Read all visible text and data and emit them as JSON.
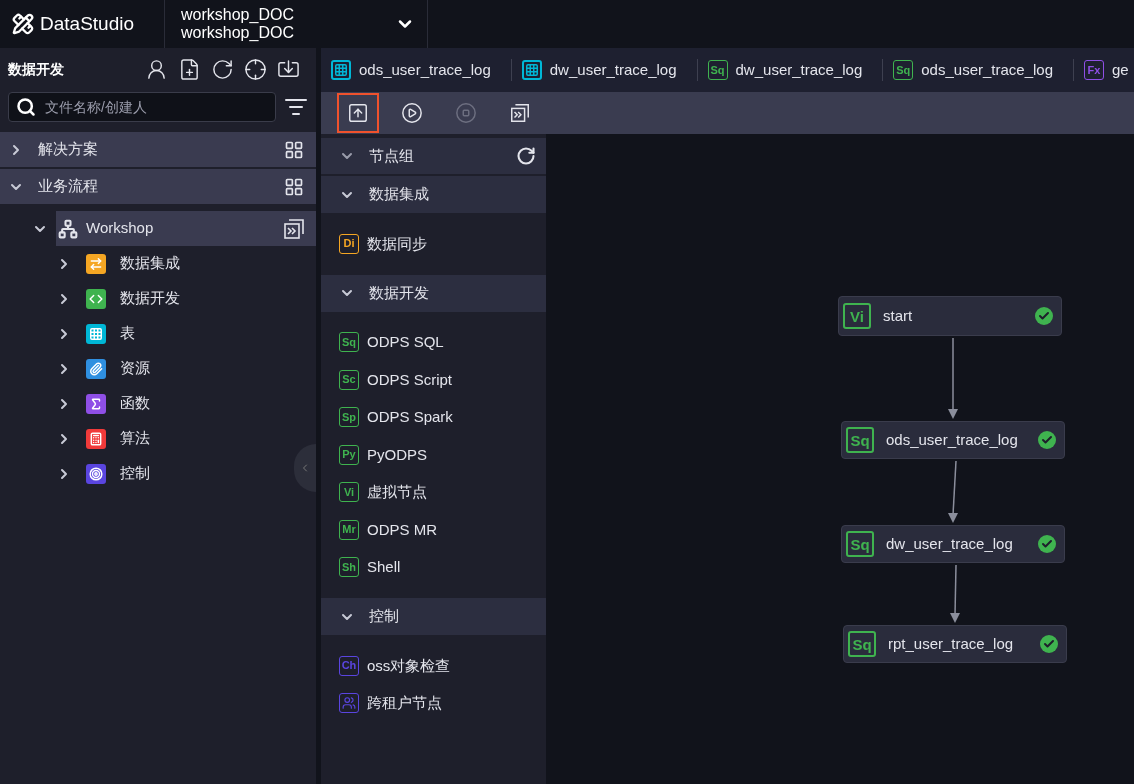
{
  "app": {
    "name": "DataStudio"
  },
  "project": {
    "lines": [
      "workshop_DOC",
      "workshop_DOC"
    ]
  },
  "sidebar": {
    "title": "数据开发",
    "search": {
      "placeholder": "文件名称/创建人"
    },
    "sections": [
      {
        "label": "解决方案",
        "expanded": false
      },
      {
        "label": "业务流程",
        "expanded": true,
        "children": [
          {
            "label": "Workshop",
            "expanded": true,
            "children": [
              {
                "label": "数据集成",
                "kind": "sync",
                "color": "#f5a623",
                "expanded": false
              },
              {
                "label": "数据开发",
                "kind": "code",
                "color": "#3fb34f",
                "expanded": false
              },
              {
                "label": "表",
                "kind": "table",
                "color": "#00b7d6",
                "expanded": false
              },
              {
                "label": "资源",
                "kind": "clip",
                "color": "#2f8fe0",
                "expanded": false
              },
              {
                "label": "函数",
                "kind": "fx",
                "color": "#8f4fe6",
                "expanded": false
              },
              {
                "label": "算法",
                "kind": "calc",
                "color": "#f03a3a",
                "expanded": false
              },
              {
                "label": "控制",
                "kind": "target",
                "color": "#5a45e0",
                "expanded": false
              }
            ]
          }
        ]
      }
    ]
  },
  "tabs": [
    {
      "label": "ods_user_trace_log",
      "kind": "table",
      "color": "#00b7d6",
      "selected": false
    },
    {
      "label": "dw_user_trace_log",
      "kind": "table",
      "color": "#00b7d6",
      "selected": false
    },
    {
      "label": "dw_user_trace_log",
      "kind": "badge",
      "badge": "Sq",
      "color": "#3fb34f",
      "selected": false
    },
    {
      "label": "ods_user_trace_log",
      "kind": "badge",
      "badge": "Sq",
      "color": "#3fb34f",
      "selected": false
    },
    {
      "label": "ge",
      "kind": "badge",
      "badge": "Fx",
      "color": "#8f4fe6",
      "selected": false
    }
  ],
  "toolbar": [
    {
      "kind": "submit",
      "highlighted": true,
      "disabled": false
    },
    {
      "kind": "run",
      "highlighted": false,
      "disabled": false
    },
    {
      "kind": "stop",
      "highlighted": false,
      "disabled": true
    },
    {
      "kind": "more",
      "highlighted": false,
      "disabled": false
    }
  ],
  "node_panel": {
    "title": "节点组",
    "groups": [
      {
        "label": "数据集成",
        "expanded": true,
        "items": [
          {
            "label": "数据同步",
            "kind": "badge",
            "badge": "Di",
            "color": "#f5a623"
          }
        ]
      },
      {
        "label": "数据开发",
        "expanded": true,
        "items": [
          {
            "label": "ODPS SQL",
            "kind": "badge",
            "badge": "Sq",
            "color": "#3fb34f"
          },
          {
            "label": "ODPS Script",
            "kind": "badge",
            "badge": "Sc",
            "color": "#3fb34f"
          },
          {
            "label": "ODPS Spark",
            "kind": "badge",
            "badge": "Sp",
            "color": "#3fb34f"
          },
          {
            "label": "PyODPS",
            "kind": "badge",
            "badge": "Py",
            "color": "#3fb34f"
          },
          {
            "label": "虚拟节点",
            "kind": "badge",
            "badge": "Vi",
            "color": "#3fb34f"
          },
          {
            "label": "ODPS MR",
            "kind": "badge",
            "badge": "Mr",
            "color": "#3fb34f"
          },
          {
            "label": "Shell",
            "kind": "badge",
            "badge": "Sh",
            "color": "#3fb34f"
          }
        ]
      },
      {
        "label": "控制",
        "expanded": true,
        "items": [
          {
            "label": "oss对象检查",
            "kind": "badge",
            "badge": "Ch",
            "color": "#5a45e0"
          },
          {
            "label": "跨租户节点",
            "kind": "people",
            "color": "#5a45e0"
          }
        ]
      }
    ]
  },
  "canvas": {
    "nodes": [
      {
        "label": "start",
        "badge": "Vi",
        "succeeded": true
      },
      {
        "label": "ods_user_trace_log",
        "badge": "Sq",
        "succeeded": true
      },
      {
        "label": "dw_user_trace_log",
        "badge": "Sq",
        "succeeded": true
      },
      {
        "label": "rpt_user_trace_log",
        "badge": "Sq",
        "succeeded": true
      }
    ]
  }
}
